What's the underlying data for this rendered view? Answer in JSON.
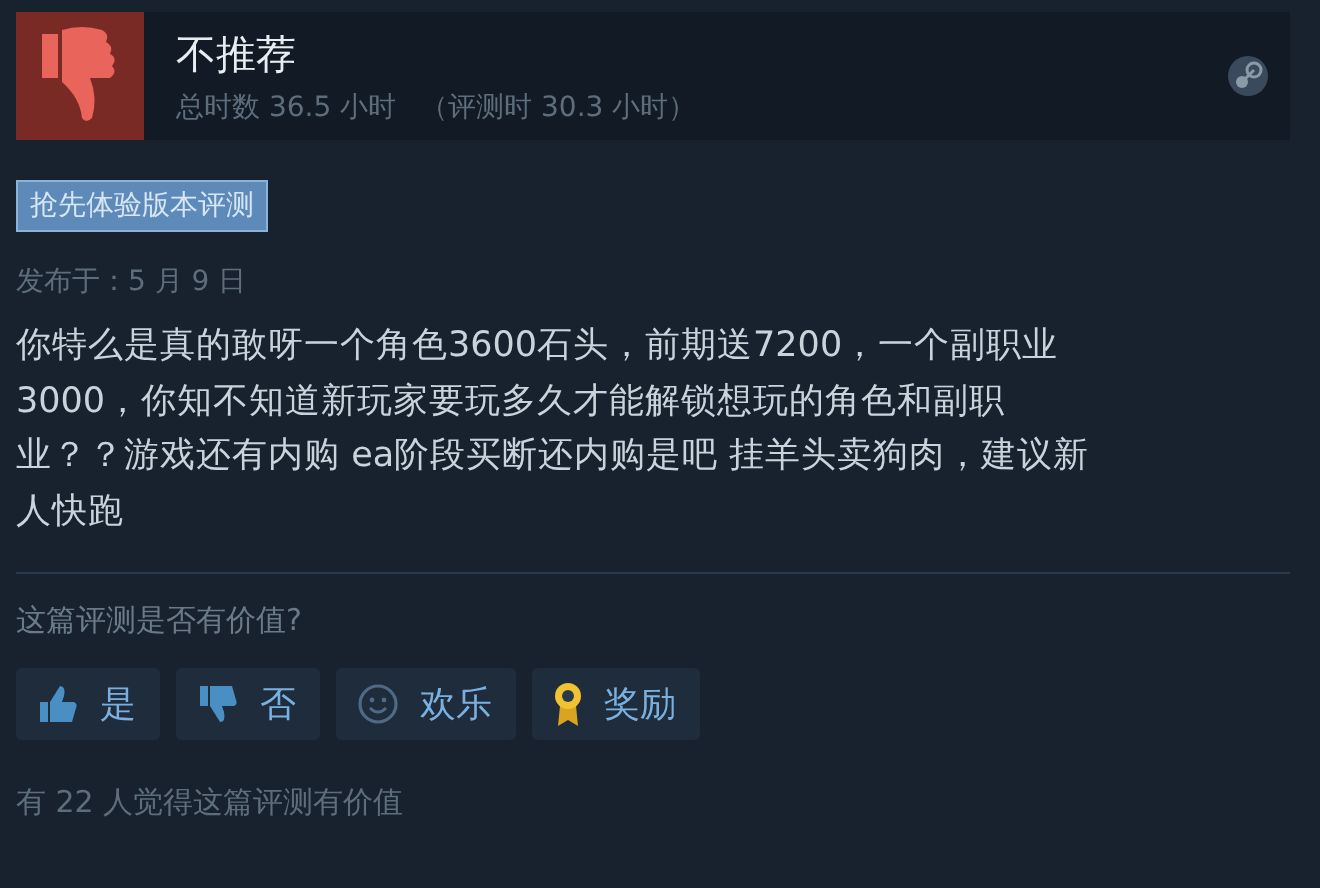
{
  "review": {
    "verdict": "不推荐",
    "recommended": false,
    "playtime": "总时数 36.5 小时",
    "playtime_at_review": "（评测时 30.3 小时）"
  },
  "badge": "抢先体验版本评测",
  "posted": "发布于：5 月 9 日",
  "body_lines": [
    "你特么是真的敢呀一个角色3600石头，前期送7200，一个副职业",
    "3000，你知不知道新玩家要玩多久才能解锁想玩的角色和副职",
    "业？？游戏还有内购 ea阶段买断还内购是吧 挂羊头卖狗肉，建议新",
    "人快跑"
  ],
  "question": "这篇评测是否有价值?",
  "buttons": [
    {
      "kind": "thumbs_up",
      "label": "是"
    },
    {
      "kind": "thumbs_down",
      "label": "否"
    },
    {
      "kind": "smile",
      "label": "欢乐"
    },
    {
      "kind": "award",
      "label": "奖励"
    }
  ],
  "helpful": "有 22 人觉得这篇评测有价值"
}
